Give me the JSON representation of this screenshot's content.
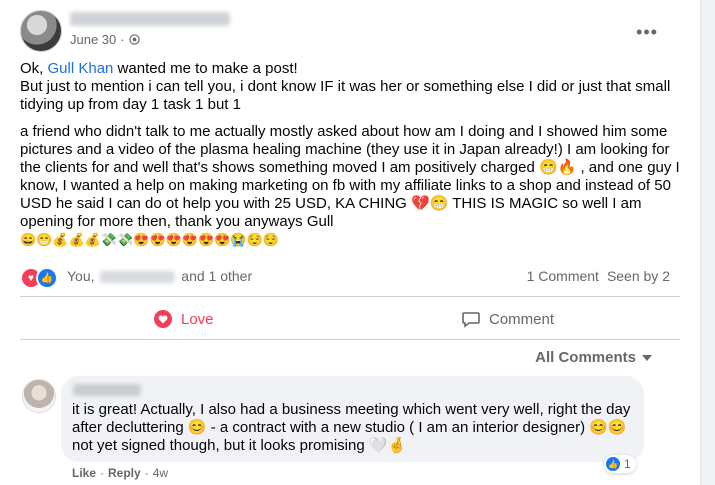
{
  "post": {
    "date": "June 30",
    "dot": "·",
    "more": "•••",
    "para1_prefix": "Ok, ",
    "mention": "Gull Khan",
    "para1_rest": "  wanted me to make a post!",
    "para1_line2": "But just to mention i can tell you, i dont know IF it was her or something else I did or just that small tidying up from day 1 task 1 but 1",
    "para2": "a friend who didn't talk to me actually mostly asked about how am I doing and I showed him some pictures and a video of the plasma healing machine (they use it in Japan already!) I am looking for the clients for and well that's shows something moved I am positively charged 😁🔥 , and one guy I know, I wanted a help on making marketing on fb with my affiliate links to a shop and instead of 50 USD he said I can do ot help you with 25 USD, KA CHING 💔😁 THIS IS MAGIC so well I am opening for more then, thank you anyways  Gull",
    "emoji_row": "😄😁💰💰💰💸💸😍😍😍😍😍😍😭😌😌"
  },
  "reactions": {
    "you": "You,",
    "and_other": "and 1 other",
    "comment_count": "1 Comment",
    "seen_by": "Seen by 2"
  },
  "actions": {
    "love": "Love",
    "comment": "Comment"
  },
  "comments": {
    "sort_label": "All Comments",
    "items": [
      {
        "text": "it is great! Actually, I also had a business meeting which went very well, right the day after decluttering 😊  - a contract with a new studio ( I am an interior designer) 😊😊 not yet signed though, but it looks promising 🤍🤞",
        "like_count": "1",
        "like": "Like",
        "sep": "·",
        "reply": "Reply",
        "time": "4w"
      }
    ]
  },
  "colors": {
    "accent": "#1877f2",
    "love": "#f33e58",
    "mention": "#216fdb",
    "muted": "#65676b"
  }
}
